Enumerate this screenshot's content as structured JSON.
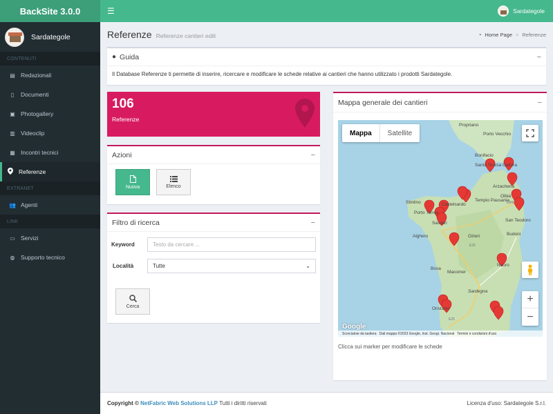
{
  "app": {
    "title": "BackSite 3.0.0",
    "user": "Sardategole"
  },
  "colors": {
    "header": "#46b88d",
    "logo": "#3c9f7a",
    "sidebar": "#222d32",
    "accent_pink": "#d81b60"
  },
  "sidebar": {
    "user": "Sardategole",
    "sections": [
      {
        "header": "CONTENUTI",
        "items": [
          {
            "label": "Redazionali",
            "icon": "newspaper-icon"
          },
          {
            "label": "Documenti",
            "icon": "document-icon"
          },
          {
            "label": "Photogallery",
            "icon": "image-icon"
          },
          {
            "label": "Videoclip",
            "icon": "film-icon"
          },
          {
            "label": "Incontri tecnici",
            "icon": "calendar-icon"
          },
          {
            "label": "Referenze",
            "icon": "map-marker-icon",
            "active": true
          }
        ]
      },
      {
        "header": "EXTRANET",
        "items": [
          {
            "label": "Agenti",
            "icon": "users-icon"
          }
        ]
      },
      {
        "header": "LINK",
        "items": [
          {
            "label": "Servizi",
            "icon": "laptop-icon"
          },
          {
            "label": "Supporto tecnico",
            "icon": "globe-icon"
          }
        ]
      }
    ]
  },
  "page": {
    "title": "Referenze",
    "subtitle": "Referenze cantieri edili"
  },
  "breadcrumb": {
    "home": "Home Page",
    "separator": ">",
    "current": "Referenze"
  },
  "guida": {
    "title": "Guida",
    "text": "Il Database Referenze ti permette di inserire, ricercare e modificare le schede relative ai cantieri che hanno utilizzato i prodotti Sardategole."
  },
  "stat": {
    "value": "106",
    "label": "Referenze",
    "icon": "map-marker-icon"
  },
  "azioni": {
    "title": "Azioni",
    "buttons": [
      {
        "label": "Nuova",
        "icon": "file-icon"
      },
      {
        "label": "Elenco",
        "icon": "list-icon"
      }
    ]
  },
  "filtro": {
    "title": "Filtro di ricerca",
    "keyword_label": "Keyword",
    "keyword_placeholder": "Testo da cercare ...",
    "location_label": "Località",
    "location_value": "Tutte",
    "search_label": "Cerca"
  },
  "map": {
    "title": "Mappa generale dei cantieri",
    "tabs": [
      "Mappa",
      "Satellite"
    ],
    "labels": [
      "Propriano",
      "Porto Vecchio",
      "Bonifacio",
      "Santa Teresa Gallura",
      "Arzachena",
      "Stintino",
      "Castelsardo",
      "Tempio Pausania",
      "Olbia",
      "E840",
      "Porto Torres",
      "Sassari",
      "San Teodoro",
      "Alghero",
      "Ozieri",
      "Budoni",
      "E25",
      "Nuoro",
      "Bosa",
      "Macomer",
      "Oristano",
      "E25",
      "Sardegna"
    ],
    "footer": [
      "Scorciatoie da tastiera",
      "Dati mappa ©2023 Google, Inst. Geogr. Nacional",
      "Termini e condizioni d'uso"
    ],
    "google": "Google",
    "caption": "Clicca sui marker per modificare le schede"
  },
  "footer": {
    "copyright_label": "Copyright ©",
    "company": "NetFabric Web Solutions LLP",
    "rights": "Tutti i diritti riservati",
    "license": "Licenza d'uso: Sardategole S.r.l."
  }
}
